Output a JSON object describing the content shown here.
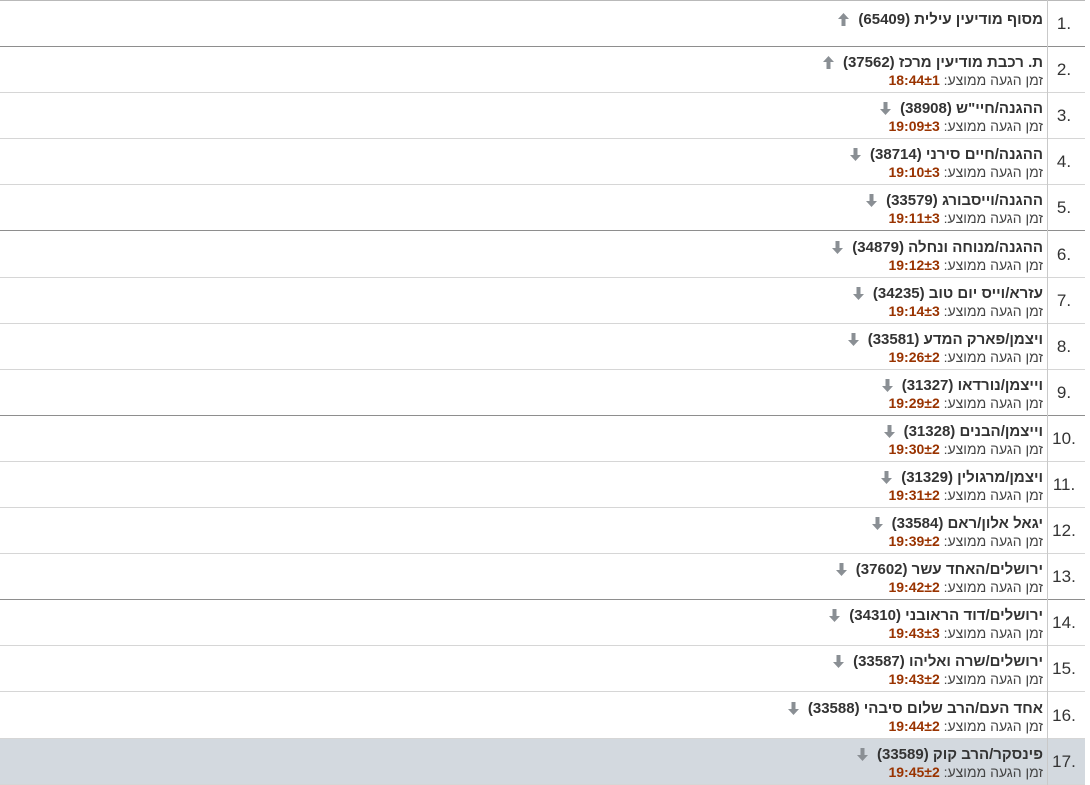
{
  "arrival_label": "זמן הגעה ממוצע:",
  "colors": {
    "time": "#993300",
    "arrow": "#8a8f94",
    "selected_row": "#d3d9df"
  },
  "stops": [
    {
      "num": "1.",
      "name": "מסוף מודיעין עילית (65409)",
      "arrow": "up-arrow-icon",
      "time": ""
    },
    {
      "num": "2.",
      "name": "ת. רכבת מודיעין מרכז (37562)",
      "arrow": "up-arrow-icon",
      "time": "18:44±1"
    },
    {
      "num": "3.",
      "name": "ההגנה/חיי\"ש (38908)",
      "arrow": "down-arrow-icon",
      "time": "19:09±3"
    },
    {
      "num": "4.",
      "name": "ההגנה/חיים סירני (38714)",
      "arrow": "down-arrow-icon",
      "time": "19:10±3"
    },
    {
      "num": "5.",
      "name": "ההגנה/וייסבורג (33579)",
      "arrow": "down-arrow-icon",
      "time": "19:11±3"
    },
    {
      "num": "6.",
      "name": "ההגנה/מנוחה ונחלה (34879)",
      "arrow": "down-arrow-icon",
      "time": "19:12±3"
    },
    {
      "num": "7.",
      "name": "עזרא/וייס יום טוב (34235)",
      "arrow": "down-arrow-icon",
      "time": "19:14±3"
    },
    {
      "num": "8.",
      "name": "ויצמן/פארק המדע (33581)",
      "arrow": "down-arrow-icon",
      "time": "19:26±2"
    },
    {
      "num": "9.",
      "name": "וייצמן/נורדאו (31327)",
      "arrow": "down-arrow-icon",
      "time": "19:29±2"
    },
    {
      "num": "10.",
      "name": "וייצמן/הבנים (31328)",
      "arrow": "down-arrow-icon",
      "time": "19:30±2"
    },
    {
      "num": "11.",
      "name": "ויצמן/מרגולין (31329)",
      "arrow": "down-arrow-icon",
      "time": "19:31±2"
    },
    {
      "num": "12.",
      "name": "יגאל אלון/ראם (33584)",
      "arrow": "down-arrow-icon",
      "time": "19:39±2"
    },
    {
      "num": "13.",
      "name": "ירושלים/האחד עשר (37602)",
      "arrow": "down-arrow-icon",
      "time": "19:42±2"
    },
    {
      "num": "14.",
      "name": "ירושלים/דוד הראובני (34310)",
      "arrow": "down-arrow-icon",
      "time": "19:43±3"
    },
    {
      "num": "15.",
      "name": "ירושלים/שרה ואליהו (33587)",
      "arrow": "down-arrow-icon",
      "time": "19:43±2"
    },
    {
      "num": "16.",
      "name": "אחד העם/הרב שלום סיבהי (33588)",
      "arrow": "down-arrow-icon",
      "time": "19:44±2"
    },
    {
      "num": "17.",
      "name": "פינסקר/הרב קוק (33589)",
      "arrow": "down-arrow-icon",
      "time": "19:45±2",
      "selected": true
    }
  ]
}
